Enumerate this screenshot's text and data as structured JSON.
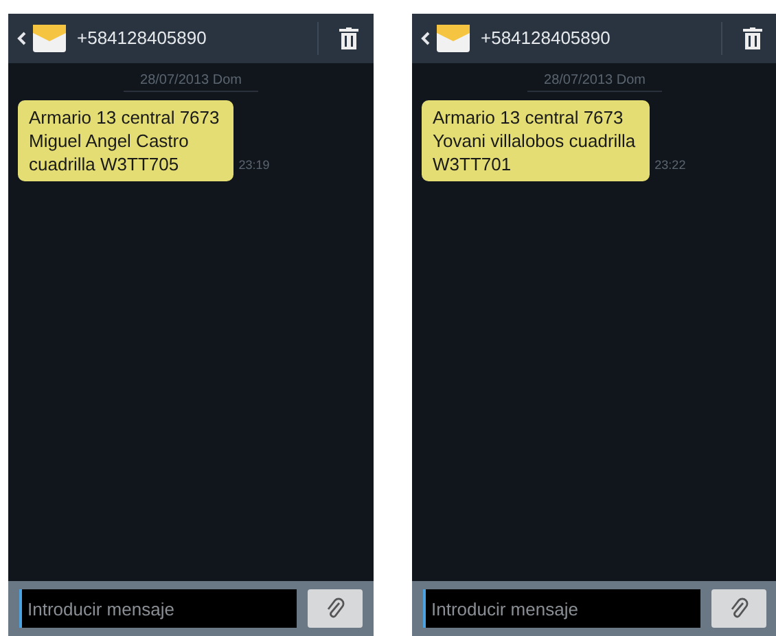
{
  "screens": [
    {
      "contact": "+584128405890",
      "date": "28/07/2013 Dom",
      "message": {
        "lines": [
          "Armario 13 central 7673",
          "Miguel Angel Castro",
          "cuadrilla W3TT705"
        ],
        "time": "23:19"
      },
      "input": {
        "placeholder": "Introducir mensaje"
      }
    },
    {
      "contact": "+584128405890",
      "date": "28/07/2013 Dom",
      "message": {
        "lines": [
          "Armario 13 central 7673",
          "Yovani villalobos cuadrilla",
          "W3TT701"
        ],
        "time": "23:22"
      },
      "input": {
        "placeholder": "Introducir mensaje"
      }
    }
  ]
}
